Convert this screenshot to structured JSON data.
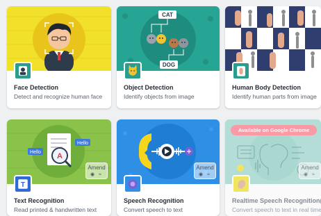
{
  "cards": [
    {
      "title": "Face Detection",
      "desc": "Detect and recognize human face"
    },
    {
      "title": "Object Detection",
      "desc": "Identify objects from image"
    },
    {
      "title": "Human Body Detection",
      "desc": "Identify human parts from image"
    },
    {
      "title": "Text Recognition",
      "desc": "Read printed & handwritten text"
    },
    {
      "title": "Speech Recognition",
      "desc": "Convert speech to text"
    },
    {
      "title": "Realtime Speech Recognition(Alp",
      "desc": "Convert speech to text in real time"
    }
  ],
  "object_labels": {
    "top": "CAT",
    "bottom": "DOG"
  },
  "text_labels": {
    "left": "Hello",
    "right": "Hello"
  },
  "chips": {
    "text_recognition": "Amend",
    "speech_recognition": "Amend",
    "realtime_speech": "Amend"
  },
  "realtime_banner": "Available on Google Chrome",
  "colors": {
    "face_bg": "#f1e12a",
    "object_bg": "#27a594",
    "body_bg": "#2f3e6e",
    "text_bg": "#8bc34a",
    "speech_bg": "#2f8fe5",
    "realtime_bg": "#9ed6cd",
    "banner": "#ff7a8a"
  }
}
